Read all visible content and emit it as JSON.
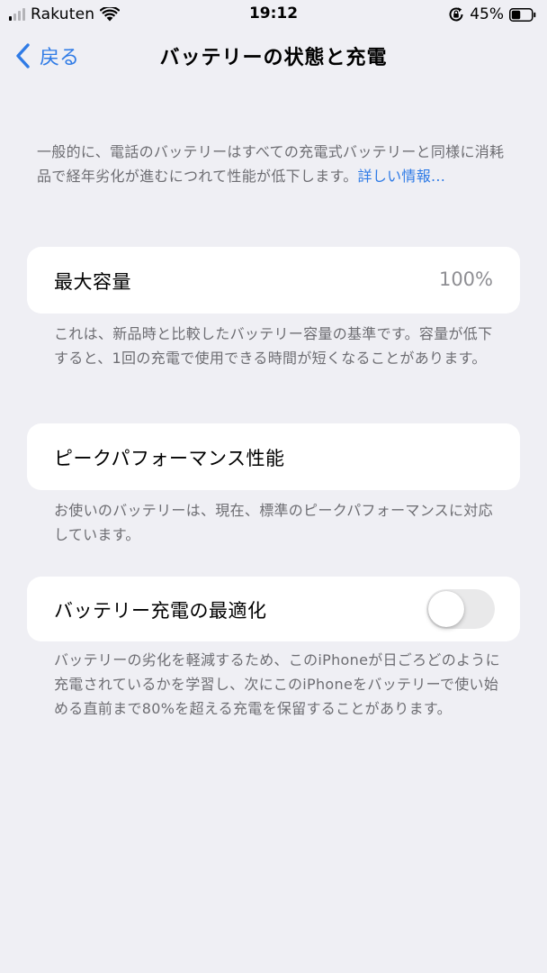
{
  "status_bar": {
    "carrier": "Rakuten",
    "time": "19:12",
    "battery_percent": "45%",
    "signal_icon": "cellular-signal-icon",
    "wifi_icon": "wifi-icon",
    "rotation_lock_icon": "rotation-lock-icon",
    "battery_icon": "battery-icon",
    "battery_level": 0.45
  },
  "nav": {
    "back_label": "戻る",
    "back_icon": "chevron-left-icon",
    "title": "バッテリーの状態と充電"
  },
  "intro": {
    "text": "一般的に、電話のバッテリーはすべての充電式バッテリーと同様に消耗品で経年劣化が進むにつれて性能が低下します。",
    "link": "詳しい情報..."
  },
  "max_capacity": {
    "label": "最大容量",
    "value": "100%",
    "footnote": "これは、新品時と比較したバッテリー容量の基準です。容量が低下すると、1回の充電で使用できる時間が短くなることがあります。"
  },
  "peak_performance": {
    "label": "ピークパフォーマンス性能",
    "footnote": "お使いのバッテリーは、現在、標準のピークパフォーマンスに対応しています。"
  },
  "optimized_charging": {
    "label": "バッテリー充電の最適化",
    "enabled": false,
    "footnote": "バッテリーの劣化を軽減するため、このiPhoneが日ごろどのように充電されているかを学習し、次にこのiPhoneをバッテリーで使い始める直前まで80%を超える充電を保留することがあります。"
  },
  "colors": {
    "background": "#efeff4",
    "accent": "#2f7be6",
    "secondary_text": "#6d6d72",
    "toggle_off": "#e9e9ea"
  }
}
